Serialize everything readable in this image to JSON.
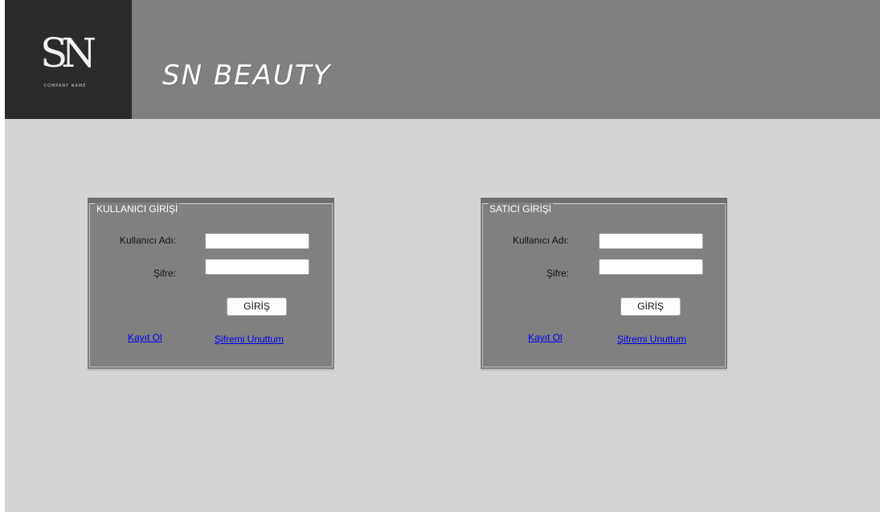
{
  "header": {
    "logo": {
      "mark": "SN",
      "subtitle": "COMPANY NAME"
    },
    "brand": "SN BEAUTY"
  },
  "panels": [
    {
      "title": "KULLANICI GİRİŞİ",
      "username_label": "Kullanıcı Adı:",
      "password_label": "Şifre:",
      "username_value": "",
      "password_value": "",
      "login_button": "GİRİŞ",
      "register_link": "Kayıt Ol",
      "forgot_link": "Şifremi Unuttum"
    },
    {
      "title": "SATICI  GİRİŞİ",
      "username_label": "Kullanıcı Adı:",
      "password_label": "Şifre:",
      "username_value": "",
      "password_value": "",
      "login_button": "GİRİŞ",
      "register_link": "Kayıt Ol",
      "forgot_link": "Şifremi Unuttum"
    }
  ],
  "colors": {
    "header_bg": "#808080",
    "logo_bg": "#2b2b2b",
    "page_bg": "#d4d4d4",
    "panel_bg": "#808080",
    "link": "#0000ee"
  }
}
